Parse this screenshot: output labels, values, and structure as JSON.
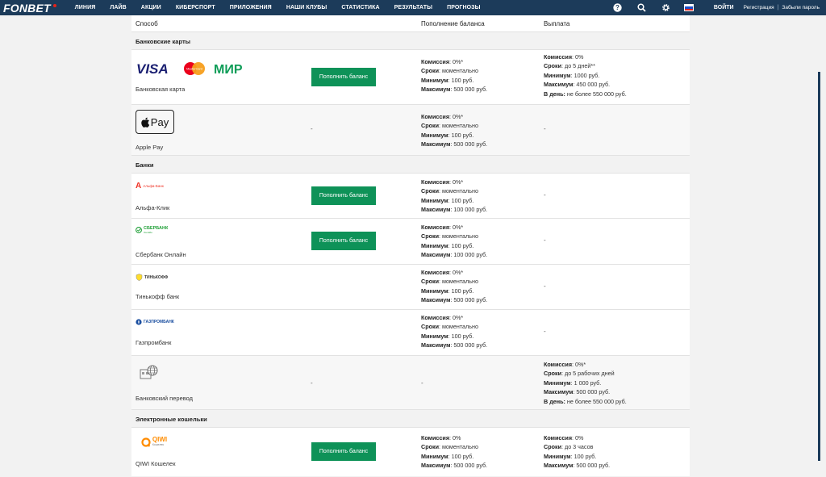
{
  "brand": {
    "name": "FONBET",
    "accent": "#e2231a",
    "bar_color": "#1c3b5a",
    "button_color": "#0e9258"
  },
  "nav": [
    "ЛИНИЯ",
    "ЛАЙВ",
    "АКЦИИ",
    "КИБЕРСПОРТ",
    "ПРИЛОЖЕНИЯ",
    "НАШИ КЛУБЫ",
    "СТАТИСТИКА",
    "РЕЗУЛЬТАТЫ",
    "ПРОГНОЗЫ"
  ],
  "topright": {
    "help_icon": "?",
    "login": "ВОЙТИ",
    "register": "Регистрация",
    "separator": "|",
    "forgot": "Забыли пароль"
  },
  "table": {
    "col_method": "Способ",
    "col_deposit": "Пополнение баланса",
    "col_withdraw": "Выплата"
  },
  "labels": {
    "commission": "Комиссия",
    "term": "Сроки",
    "min": "Минимум",
    "max": "Максимум",
    "per_day": "В день:",
    "deposit_button": "Пополнить баланс",
    "dash": "-"
  },
  "sections": {
    "cards": "Банковские карты",
    "banks": "Банки",
    "wallets": "Электронные кошельки"
  },
  "rows": {
    "card": {
      "name": "Банковская карта",
      "logos": [
        "VISA",
        "MasterCard",
        "МИР"
      ],
      "deposit": {
        "commission": ": 0%*",
        "term": ": моментально",
        "min": ": 100 руб.",
        "max": ": 500 000 руб."
      },
      "withdraw": {
        "commission": ": 0%",
        "term": ": до 5 дней**",
        "min": ": 1000 руб.",
        "max": ": 450 000 руб.",
        "per_day": " не более 550 000 руб."
      }
    },
    "applepay": {
      "name": "Apple Pay",
      "logo": "Pay",
      "deposit": {
        "commission": ": 0%*",
        "term": ": моментально",
        "min": ": 100 руб.",
        "max": ": 500 000 руб."
      }
    },
    "alfa": {
      "name": "Альфа-Клик",
      "logo": "Альфа-Банк",
      "deposit": {
        "commission": ": 0%*",
        "term": ": моментально",
        "min": ": 100 руб.",
        "max": ": 100 000 руб."
      }
    },
    "sber": {
      "name": "Сбербанк Онлайн",
      "logo": "СБЕРБАНК",
      "logo_sub": "Онлайн",
      "deposit": {
        "commission": ": 0%*",
        "term": ": моментально",
        "min": ": 100 руб.",
        "max": ": 100 000 руб."
      }
    },
    "tinkoff": {
      "name": "Тинькофф банк",
      "logo": "ТИНЬКОФФ",
      "deposit": {
        "commission": ": 0%*",
        "term": ": моментально",
        "min": ": 100 руб.",
        "max": ": 500 000 руб."
      }
    },
    "gazprom": {
      "name": "Газпромбанк",
      "logo": "ГАЗПРОМБАНК",
      "deposit": {
        "commission": ": 0%*",
        "term": ": моментально",
        "min": ": 100 руб.",
        "max": ": 500 000 руб."
      }
    },
    "transfer": {
      "name": "Банковский перевод",
      "withdraw": {
        "commission": ": 0%*",
        "term": ": до 5 рабочих дней",
        "min": ": 1 000 руб.",
        "max": ": 500 000 руб.",
        "per_day": " не более 550 000 руб."
      }
    },
    "qiwi": {
      "name": "QIWI Кошелек",
      "logo": "QIWI",
      "logo_sub": "Кошелек",
      "deposit": {
        "commission": ": 0%",
        "term": ": моментально",
        "min": ": 100 руб.",
        "max": ": 500 000 руб."
      },
      "withdraw": {
        "commission": ": 0%",
        "term": ": до 3 часов",
        "min": ": 100 руб.",
        "max": ": 500 000 руб."
      }
    }
  }
}
